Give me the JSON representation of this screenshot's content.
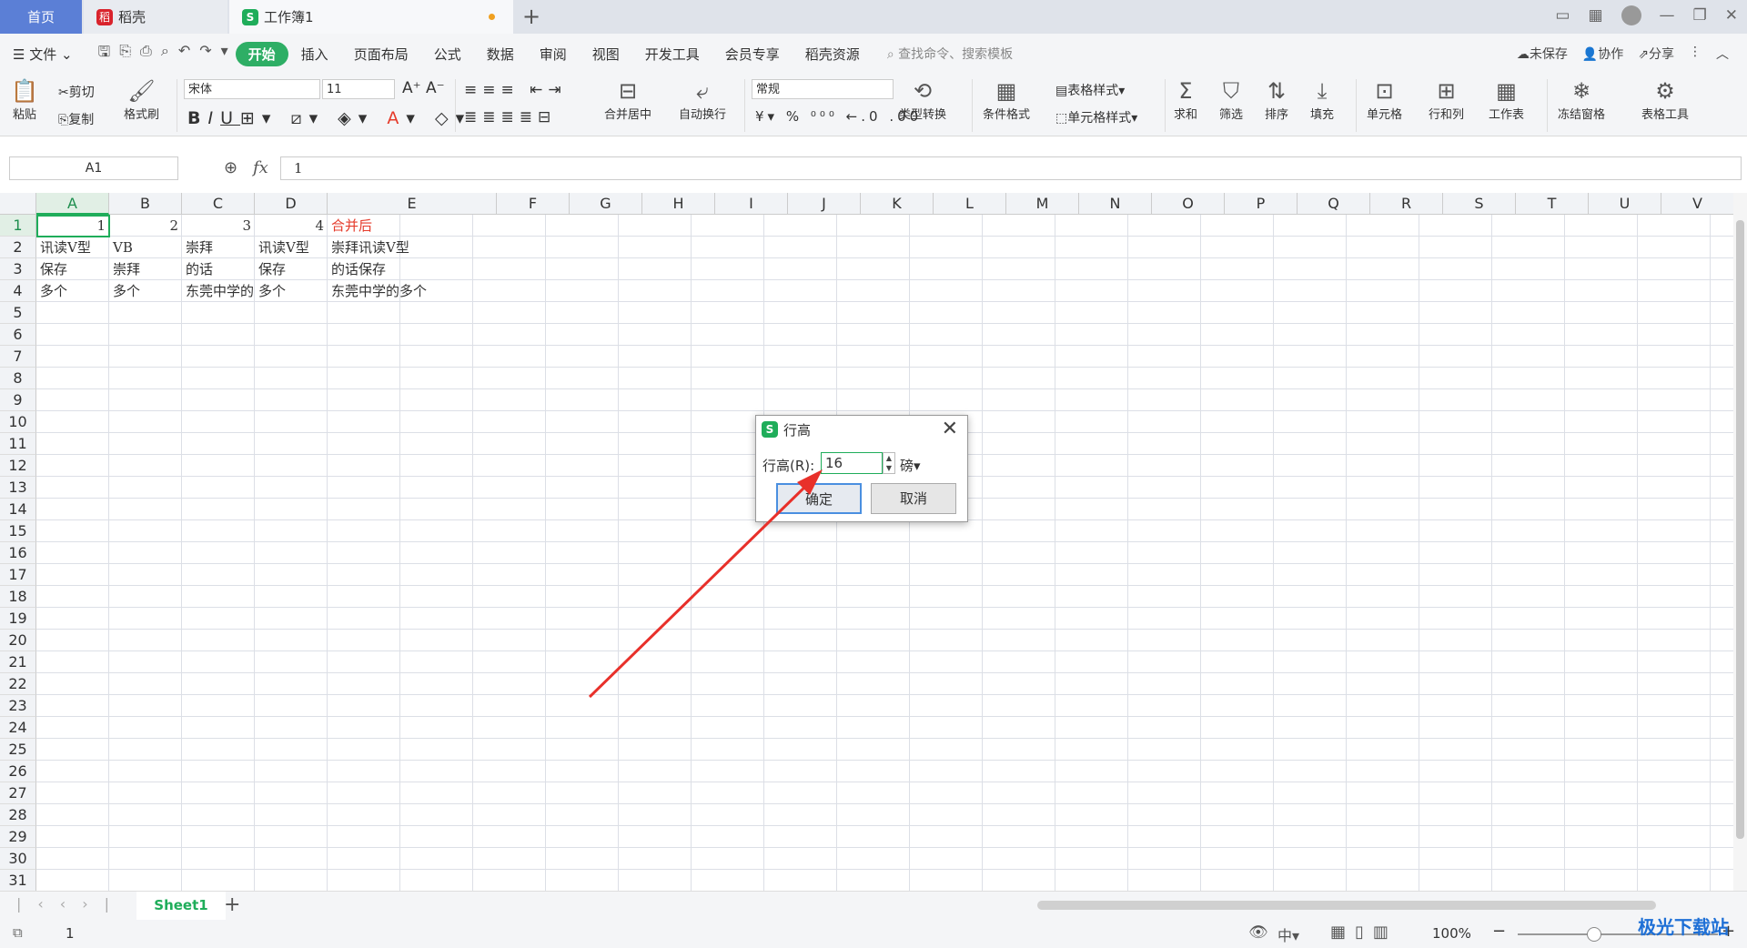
{
  "tabs": {
    "home": "首页",
    "daoke": "稻壳",
    "workbook": "工作簿1"
  },
  "menu": {
    "file": "文件",
    "items": [
      "开始",
      "插入",
      "页面布局",
      "公式",
      "数据",
      "审阅",
      "视图",
      "开发工具",
      "会员专享",
      "稻壳资源"
    ],
    "search": "查找命令、搜索模板",
    "unsaved": "未保存",
    "collab": "协作",
    "share": "分享"
  },
  "ribbon": {
    "paste": "粘贴",
    "cut": "剪切",
    "copy": "复制",
    "format_painter": "格式刷",
    "font": "宋体",
    "font_size": "11",
    "merge": "合并居中",
    "wrap": "自动换行",
    "number_format": "常规",
    "type_convert": "类型转换",
    "cond_format": "条件格式",
    "table_style": "表格样式",
    "cell_style": "单元格样式",
    "sum": "求和",
    "filter": "筛选",
    "sort": "排序",
    "fill": "填充",
    "cell": "单元格",
    "row_col": "行和列",
    "worksheet": "工作表",
    "freeze": "冻结窗格",
    "table_tools": "表格工具"
  },
  "formula_bar": {
    "name_box": "A1",
    "fx": "fx",
    "value": "1"
  },
  "columns": [
    "A",
    "B",
    "C",
    "D",
    "E",
    "F",
    "G",
    "H",
    "I",
    "J",
    "K",
    "L",
    "M",
    "N",
    "O",
    "P",
    "Q",
    "R",
    "S",
    "T",
    "U",
    "V"
  ],
  "rows": [
    "1",
    "2",
    "3",
    "4",
    "5",
    "6",
    "7",
    "8",
    "9",
    "10",
    "11",
    "12",
    "13",
    "14",
    "15",
    "16",
    "17",
    "18",
    "19",
    "20",
    "21",
    "22",
    "23",
    "24",
    "25",
    "26",
    "27",
    "28",
    "29",
    "30",
    "31"
  ],
  "cells": {
    "a1": "1",
    "b1": "2",
    "c1": "3",
    "d1": "4",
    "e1": "合并后",
    "a2": "讯读V型",
    "b2": "VB",
    "c2": "崇拜",
    "d2": "讯读V型",
    "e2": "崇拜讯读V型",
    "a3": "保存",
    "b3": "崇拜",
    "c3": "的话",
    "d3": "保存",
    "e3": "的话保存",
    "a4": "多个",
    "b4": "多个",
    "c4": "东莞中学的",
    "d4": "多个",
    "e4": "东莞中学的多个"
  },
  "sheet": {
    "name": "Sheet1"
  },
  "status": {
    "page": "1",
    "zoom": "100%"
  },
  "dialog": {
    "title": "行高",
    "label": "行高(R):",
    "value": "16",
    "unit": "磅",
    "ok": "确定",
    "cancel": "取消"
  },
  "watermark": "极光下载站",
  "colors": {
    "accent": "#1fad5a",
    "red_text": "#e53a2a",
    "arrow": "#e8302a"
  }
}
